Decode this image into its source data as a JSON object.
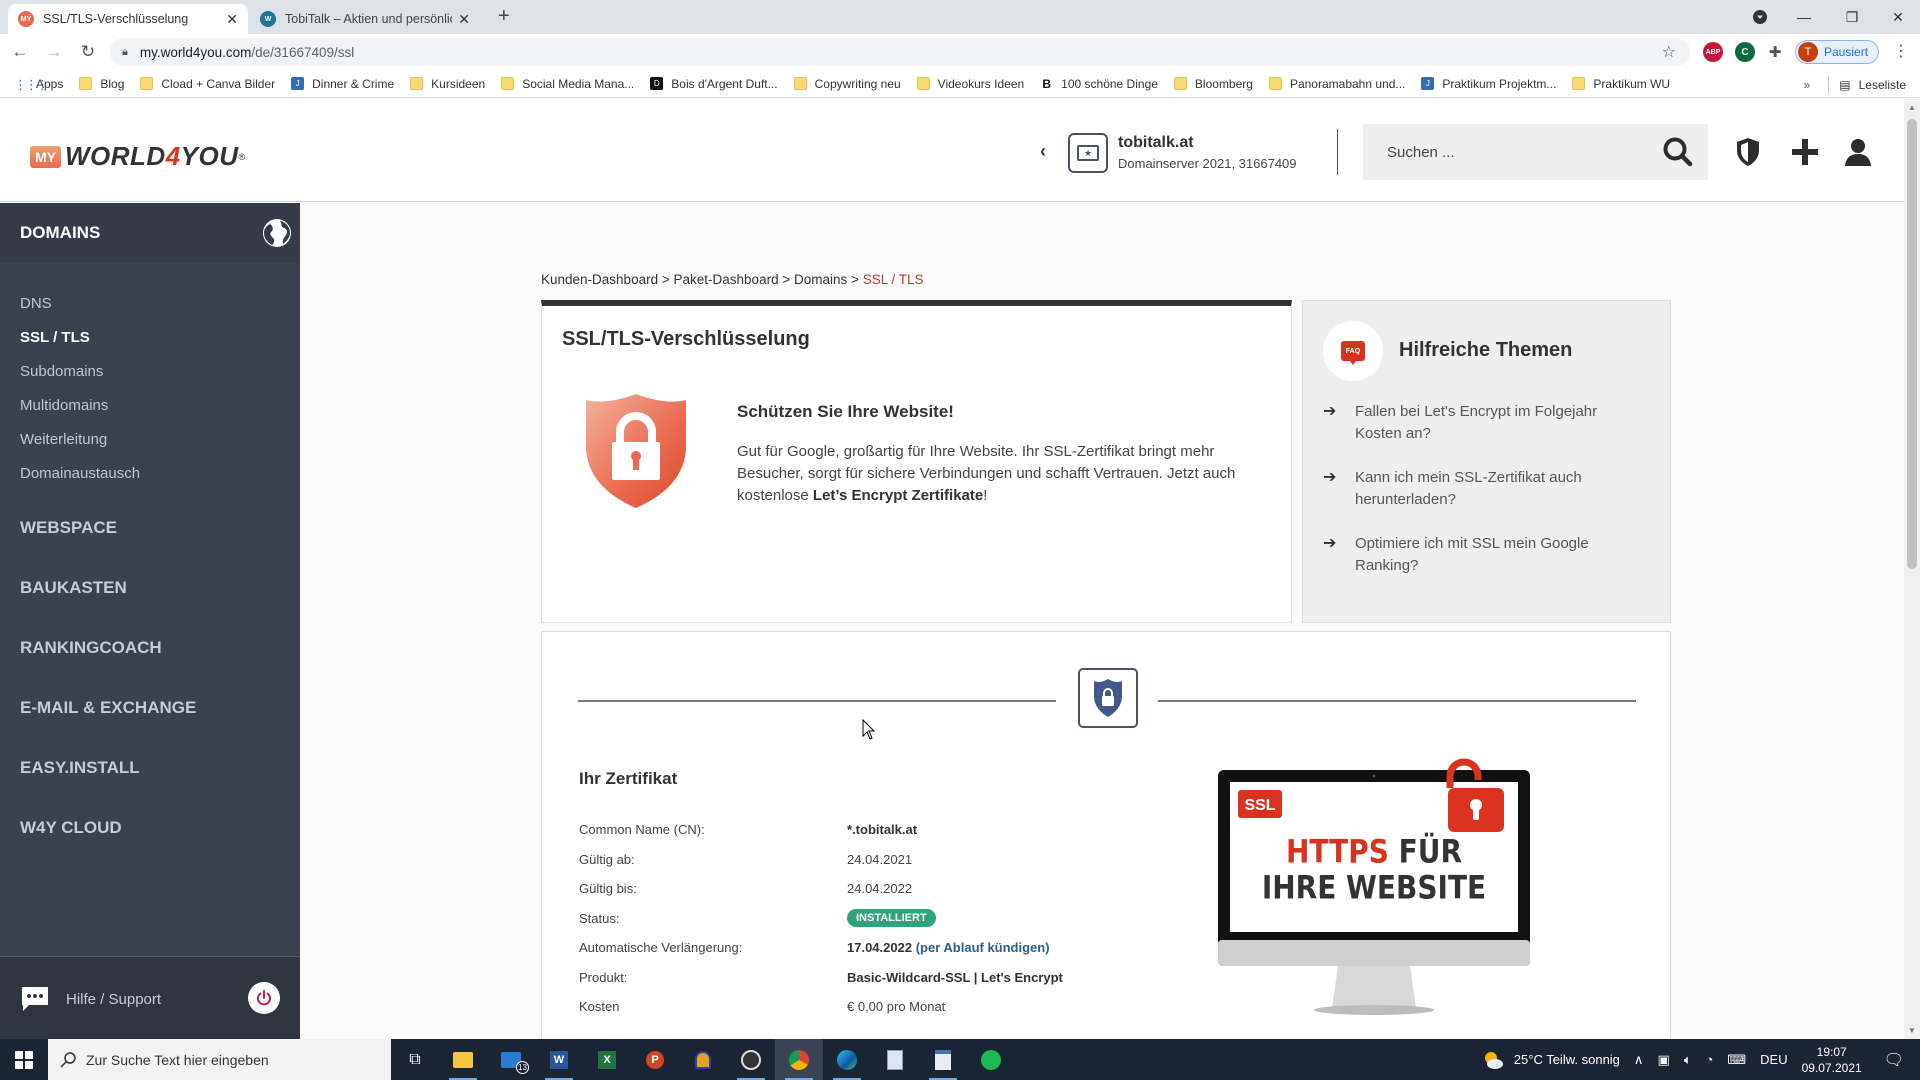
{
  "browser": {
    "tabs": [
      {
        "title": "SSL/TLS-Verschlüsselung",
        "favicon": "myworld4you-favicon",
        "active": true
      },
      {
        "title": "TobiTalk – Aktien und persönliche",
        "favicon": "wordpress-favicon",
        "active": false
      }
    ],
    "new_tab_label": "+",
    "url_host": "my.world4you.com",
    "url_path": "/de/31667409/ssl",
    "profile_initial": "T",
    "profile_status": "Pausiert",
    "extensions": [
      "ABP",
      "C"
    ],
    "bookmarks": [
      {
        "label": "Apps",
        "icon": "apps-grid"
      },
      {
        "label": "Blog",
        "icon": "folder"
      },
      {
        "label": "Cload + Canva Bilder",
        "icon": "folder"
      },
      {
        "label": "Dinner & Crime",
        "icon": "blue-site"
      },
      {
        "label": "Kursideen",
        "icon": "folder"
      },
      {
        "label": "Social Media Mana...",
        "icon": "folder"
      },
      {
        "label": "Bois d'Argent Duft...",
        "icon": "black-site"
      },
      {
        "label": "Copywriting neu",
        "icon": "folder"
      },
      {
        "label": "Videokurs Ideen",
        "icon": "folder"
      },
      {
        "label": "100 schöne Dinge",
        "icon": "b-site"
      },
      {
        "label": "Bloomberg",
        "icon": "folder"
      },
      {
        "label": "Panoramabahn und...",
        "icon": "folder"
      },
      {
        "label": "Praktikum Projektm...",
        "icon": "blue-site"
      },
      {
        "label": "Praktikum WU",
        "icon": "folder"
      }
    ],
    "bookmarks_overflow": "»",
    "reading_list": "Leseliste"
  },
  "header": {
    "logo_my": "MY",
    "logo_world": "WORLD",
    "logo_four": "4",
    "logo_you": "YOU",
    "logo_reg": "®",
    "server_name": "tobitalk.at",
    "server_sub": "Domainserver 2021, 31667409",
    "search_placeholder": "Suchen ..."
  },
  "sidebar": {
    "section_title": "DOMAINS",
    "sub_items": [
      {
        "label": "DNS",
        "active": false
      },
      {
        "label": "SSL / TLS",
        "active": true
      },
      {
        "label": "Subdomains",
        "active": false
      },
      {
        "label": "Multidomains",
        "active": false
      },
      {
        "label": "Weiterleitung",
        "active": false
      },
      {
        "label": "Domainaustausch",
        "active": false
      }
    ],
    "main_items": [
      "WEBSPACE",
      "BAUKASTEN",
      "RANKINGCOACH",
      "E-MAIL & EXCHANGE",
      "EASY.INSTALL",
      "W4Y CLOUD"
    ],
    "help_label": "Hilfe / Support"
  },
  "breadcrumb": {
    "items": [
      "Kunden-Dashboard",
      "Paket-Dashboard",
      "Domains"
    ],
    "separator": ">",
    "current": "SSL / TLS"
  },
  "ssl_card": {
    "title": "SSL/TLS-Verschlüsselung",
    "headline": "Schützen Sie Ihre Website!",
    "description_start": "Gut für Google, großartig für Ihre Website. Ihr SSL-Zertifikat bringt mehr Besucher, sorgt für sichere Verbindungen und schafft Vertrauen. Jetzt auch kostenlose ",
    "description_bold": "Let’s Encrypt Zertifikate",
    "description_end": "!"
  },
  "help_card": {
    "faq_badge": "FAQ",
    "title": "Hilfreiche Themen",
    "topics": [
      {
        "line1": "Fallen bei Let's Encrypt im Folgejahr",
        "line2": "Kosten an?"
      },
      {
        "line1": "Kann ich mein SSL-Zertifikat auch",
        "line2": "herunterladen?"
      },
      {
        "line1": "Optimiere ich mit SSL mein Google",
        "line2": "Ranking?"
      }
    ]
  },
  "certificate": {
    "title": "Ihr Zertifikat",
    "rows": [
      {
        "label": "Common Name (CN):",
        "value": "*.tobitalk.at"
      },
      {
        "label": "Gültig ab:",
        "value": "24.04.2021"
      },
      {
        "label": "Gültig bis:",
        "value": "24.04.2022"
      },
      {
        "label": "Status:",
        "value": "INSTALLIERT"
      },
      {
        "label": "Automatische Verlängerung:",
        "value": "17.04.2022",
        "link": "(per Ablauf kündigen)"
      },
      {
        "label": "Produkt:",
        "value": "Basic-Wildcard-SSL | Let's Encrypt"
      },
      {
        "label": "Kosten",
        "value": "€ 0,00 pro Monat"
      }
    ],
    "status_color": "#2fa37e",
    "promo": {
      "badge": "SSL",
      "line1_red": "HTTPS",
      "line1_dark": " FÜR",
      "line2": "IHRE WEBSITE"
    }
  },
  "taskbar": {
    "search_placeholder": "Zur Suche Text hier eingeben",
    "mail_badge": "13",
    "weather": "25°C  Teilw. sonnig",
    "language": "DEU",
    "time": "19:07",
    "date": "09.07.2021"
  },
  "colors": {
    "accent_red": "#d9331f",
    "sidebar_bg": "#3a4250",
    "breadcrumb_current": "#c0392b"
  }
}
